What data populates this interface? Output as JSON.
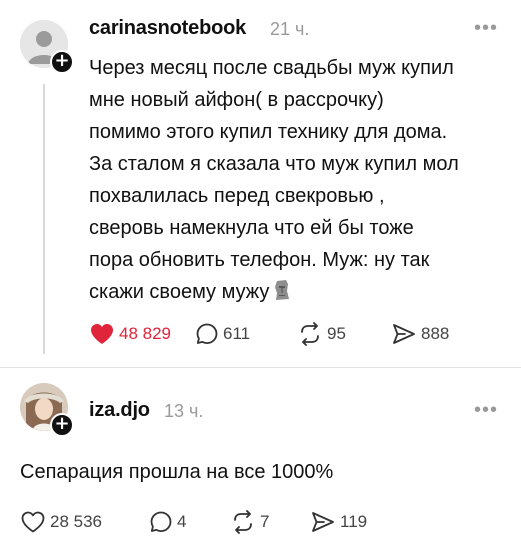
{
  "posts": [
    {
      "username": "carinasnotebook",
      "time": "21 ч.",
      "more_icon": "more-dots-icon",
      "text": "Через месяц после свадьбы муж купил\nмне новый айфон( в рассрочку)\nпомимо этого купил технику для дома.\nЗа сталом я сказала что муж купил мол\nпохвалилась перед свекровью ,\nсверовь намекнула что ей бы тоже\nпора обновить телефон. Муж: ну так\nскажи своему мужу",
      "emoji_icon": "moai-icon",
      "likes": "48 829",
      "liked": true,
      "replies": "611",
      "reposts": "95",
      "shares": "888"
    },
    {
      "username": "iza.djo",
      "time": "13 ч.",
      "more_icon": "more-dots-icon",
      "text": "Сепарация прошла на все 1000%",
      "likes": "28 536",
      "liked": false,
      "replies": "4",
      "reposts": "7",
      "shares": "119"
    }
  ],
  "colors": {
    "like_active": "#e0243a",
    "muted": "#9a9a9a",
    "text": "#111111"
  }
}
